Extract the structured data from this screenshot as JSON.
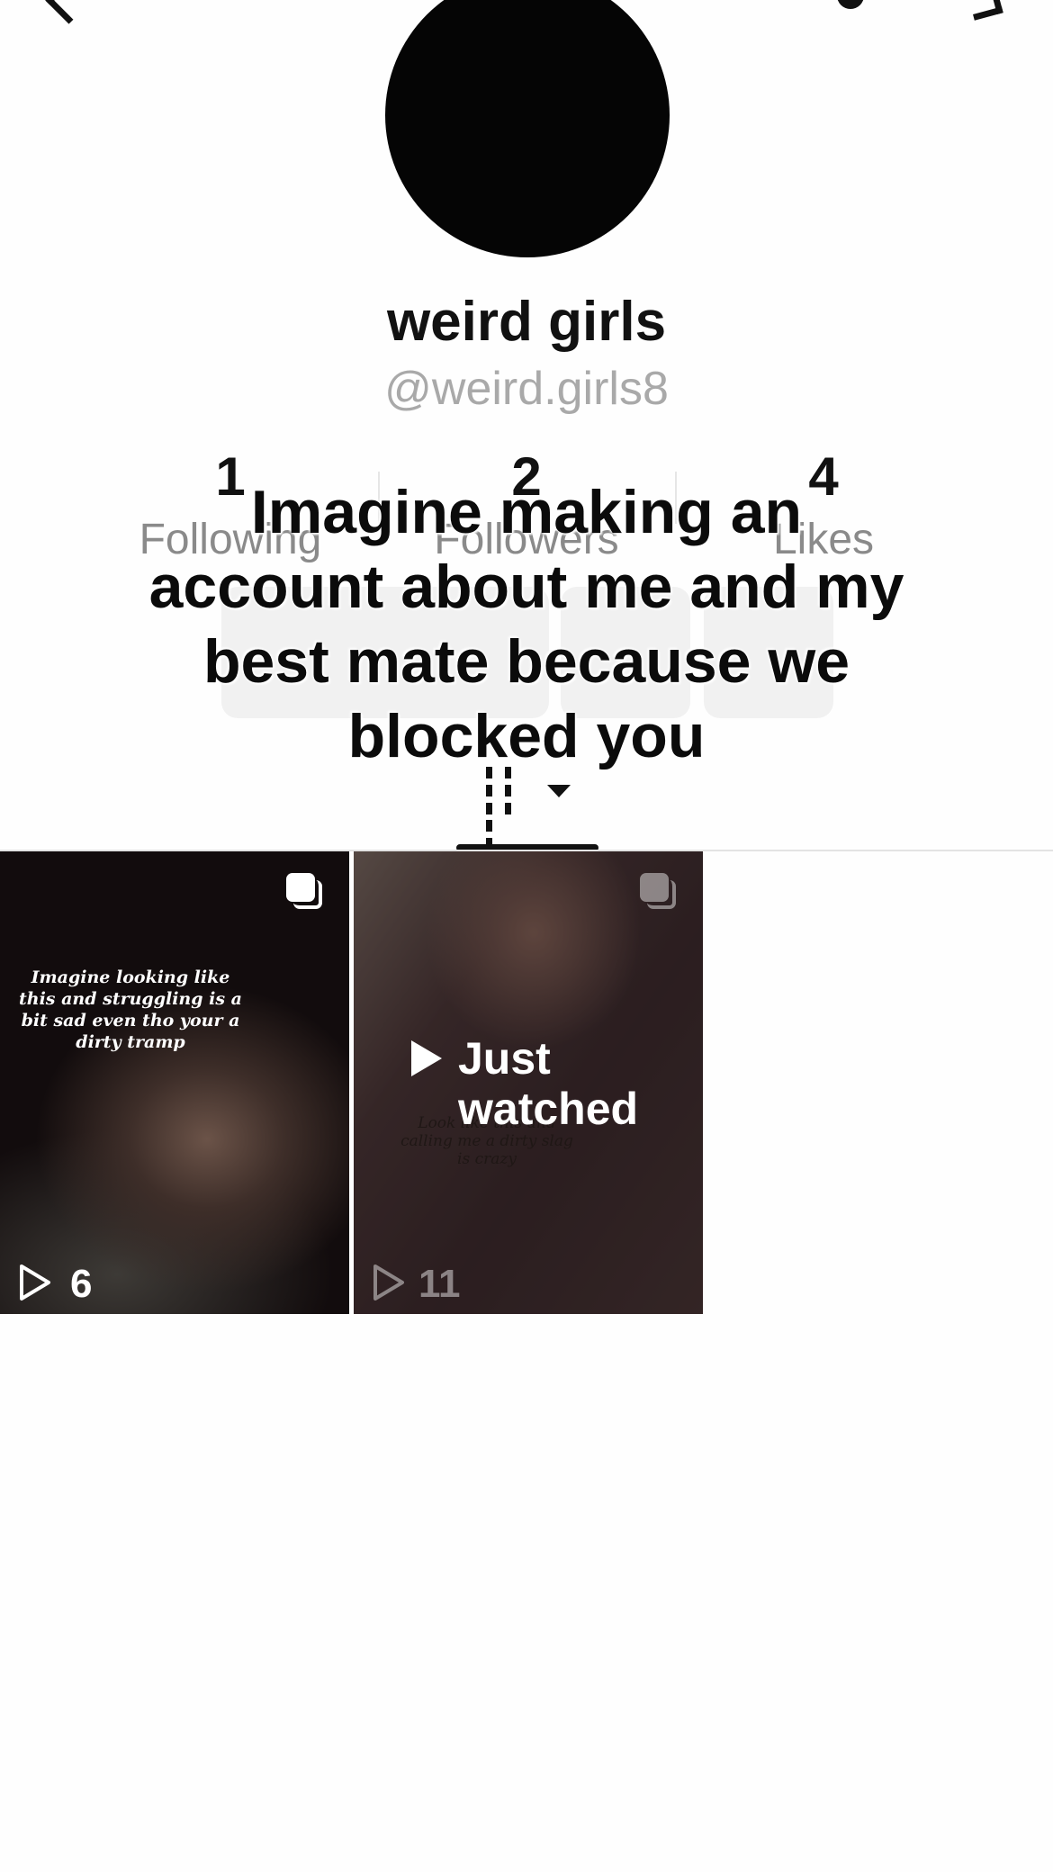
{
  "profile": {
    "display_name": "weird girls",
    "handle": "@weird.girls8"
  },
  "stats": [
    {
      "value": "1",
      "label": "Following"
    },
    {
      "value": "2",
      "label": "Followers"
    },
    {
      "value": "4",
      "label": "Likes"
    }
  ],
  "overlay": {
    "text": "Imagine making an account about me and my best mate because we blocked you"
  },
  "videos": [
    {
      "caption": "Imagine looking like this and struggling is a bit sad even tho your a dirty tramp",
      "views": "6"
    },
    {
      "caption": "Look like this and calling me a dirty slag is crazy",
      "views": "11",
      "badge": "Just watched"
    }
  ]
}
